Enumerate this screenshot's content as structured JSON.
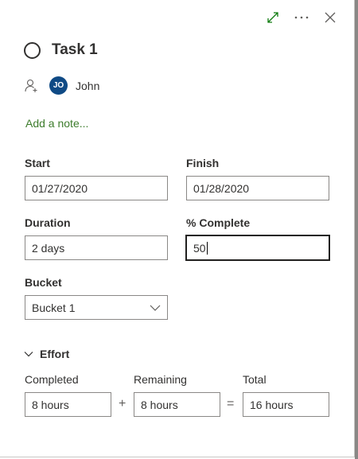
{
  "task": {
    "title": "Task 1",
    "assignee": {
      "initials": "JO",
      "name": "John"
    },
    "add_note": "Add a note..."
  },
  "header": {
    "icons": [
      "expand-icon",
      "more-icon",
      "close-icon"
    ],
    "accent_color": "#107c10"
  },
  "dates": {
    "start_label": "Start",
    "start_value": "01/27/2020",
    "finish_label": "Finish",
    "finish_value": "01/28/2020"
  },
  "duration": {
    "label": "Duration",
    "value": "2 days"
  },
  "percent_complete": {
    "label": "% Complete",
    "value": "50"
  },
  "bucket": {
    "label": "Bucket",
    "value": "Bucket 1"
  },
  "effort": {
    "title": "Effort",
    "completed_label": "Completed",
    "completed_value": "8 hours",
    "remaining_label": "Remaining",
    "remaining_value": "8 hours",
    "total_label": "Total",
    "total_value": "16 hours",
    "plus": "+",
    "equals": "="
  }
}
